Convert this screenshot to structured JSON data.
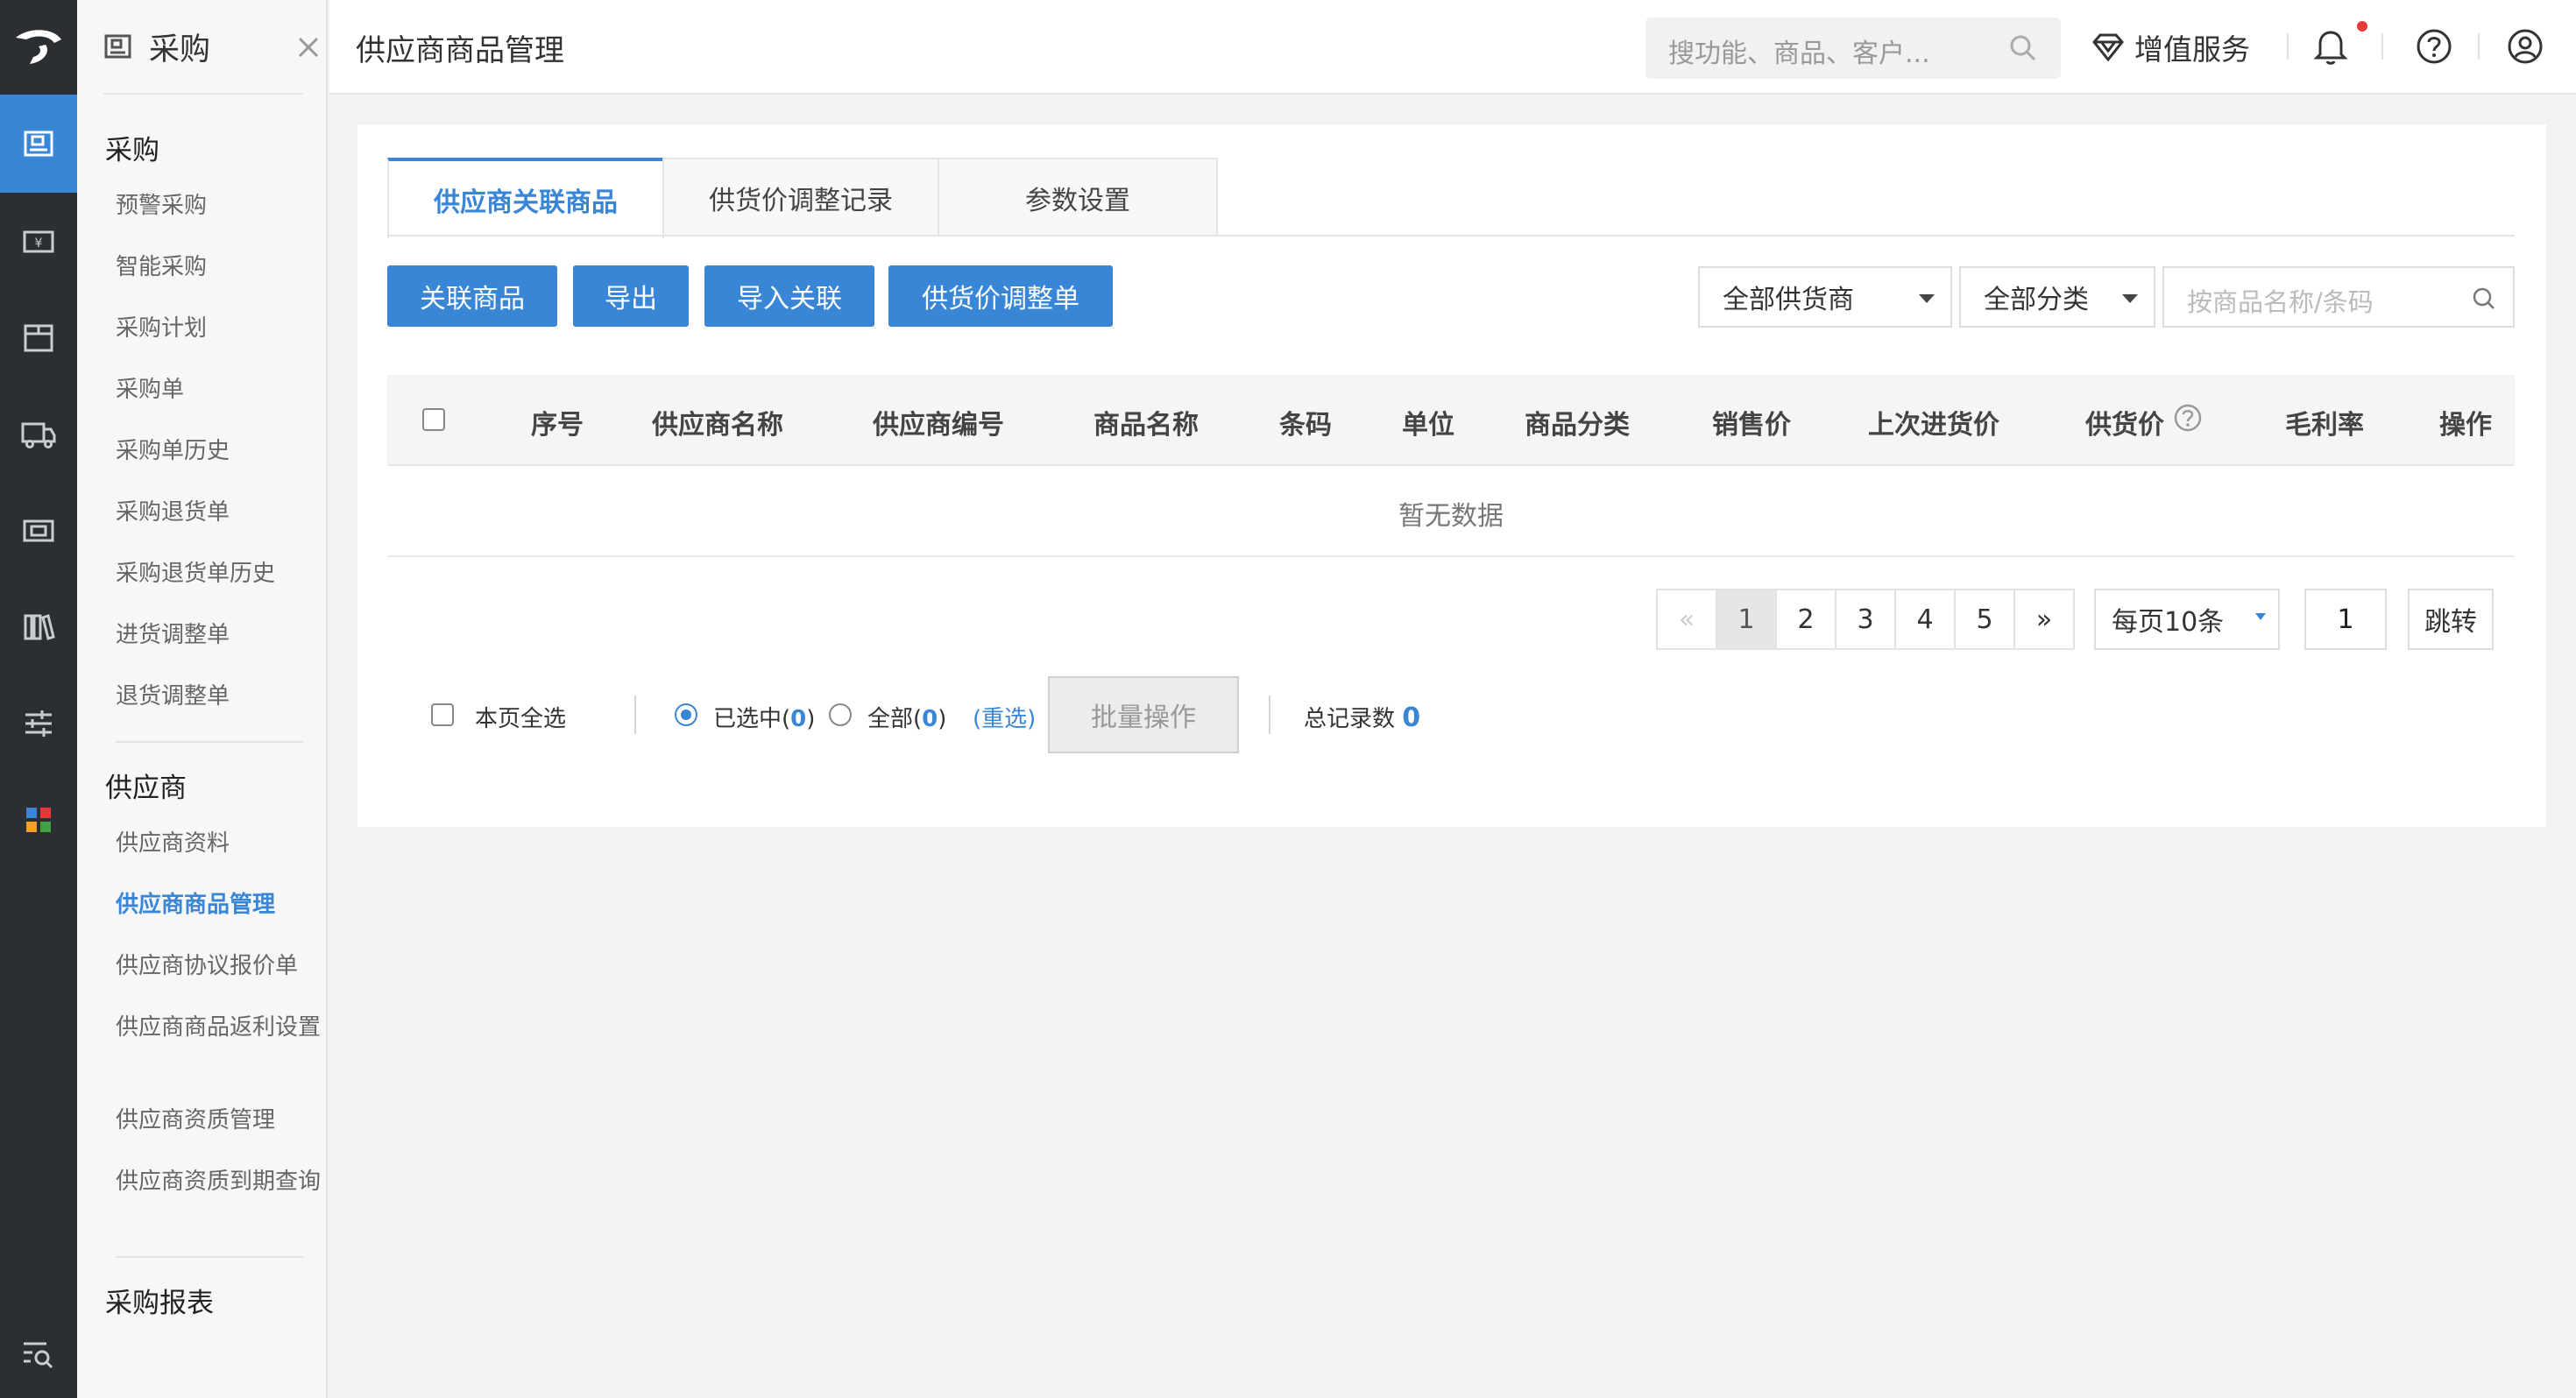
{
  "nav_rail": {
    "items": [
      "brand-logo-icon",
      "purchase-icon",
      "finance-icon",
      "inventory-icon",
      "delivery-icon",
      "store-icon",
      "books-icon",
      "settings-sliders-icon",
      "apps-icon",
      "search-menu-icon"
    ]
  },
  "submenu": {
    "title": "采购",
    "groups": [
      {
        "label": "采购",
        "items": [
          "预警采购",
          "智能采购",
          "采购计划",
          "采购单",
          "采购单历史",
          "采购退货单",
          "采购退货单历史",
          "进货调整单",
          "退货调整单"
        ]
      },
      {
        "label": "供应商",
        "items": [
          "供应商资料",
          "供应商商品管理",
          "供应商协议报价单",
          "供应商商品返利设置",
          "供应商资质管理",
          "供应商资质到期查询"
        ]
      },
      {
        "label": "采购报表",
        "items": []
      }
    ],
    "active_item": "供应商商品管理"
  },
  "header": {
    "page_title": "供应商商品管理",
    "search_placeholder": "搜功能、商品、客户...",
    "value_added_label": "增值服务"
  },
  "tabs": [
    "供应商关联商品",
    "供货价调整记录",
    "参数设置"
  ],
  "active_tab": "供应商关联商品",
  "toolbar": {
    "buttons": [
      "关联商品",
      "导出",
      "导入关联",
      "供货价调整单"
    ],
    "supplier_select": "全部供货商",
    "category_select": "全部分类",
    "search_placeholder": "按商品名称/条码"
  },
  "table": {
    "columns": [
      "序号",
      "供应商名称",
      "供应商编号",
      "商品名称",
      "条码",
      "单位",
      "商品分类",
      "销售价",
      "上次进货价",
      "供货价",
      "毛利率",
      "操作"
    ],
    "empty_text": "暂无数据"
  },
  "pagination": {
    "prev": "«",
    "pages": [
      "1",
      "2",
      "3",
      "4",
      "5"
    ],
    "current": "1",
    "next": "»",
    "per_page": "每页10条",
    "jump_value": "1",
    "jump_label": "跳转"
  },
  "batch": {
    "select_page_label": "本页全选",
    "selected_label": "已选中(",
    "selected_count": "0",
    "all_label": "全部(",
    "all_count": "0",
    "close_paren": ")",
    "reselect": "(重选)",
    "batch_button": "批量操作",
    "total_label": "总记录数",
    "total_value": "0"
  },
  "colors": {
    "accent": "#3a86d6",
    "rail_bg": "#2b2e33",
    "alert_dot": "#e53935"
  }
}
